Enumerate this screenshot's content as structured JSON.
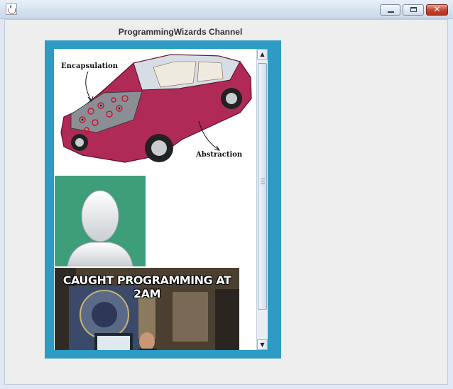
{
  "window": {
    "title": "",
    "controls": [
      "minimize",
      "maximize",
      "close"
    ]
  },
  "channel": {
    "title": "ProgrammingWizards Channel"
  },
  "images": [
    {
      "kind": "car-diagram",
      "labels": {
        "top": "Encapsulation",
        "bottom": "Abstraction"
      }
    },
    {
      "kind": "default-avatar"
    },
    {
      "kind": "meme",
      "caption": "CAUGHT PROGRAMMING AT 2AM"
    }
  ],
  "colors": {
    "panel_border": "#2d9bc4",
    "frame_background": "#eeeeee",
    "avatar_background": "#3e9e7a",
    "car_body": "#b02a57"
  },
  "icons": {
    "app": "java-cup-icon",
    "minimize": "minimize-icon",
    "maximize": "maximize-icon",
    "close": "close-icon"
  }
}
